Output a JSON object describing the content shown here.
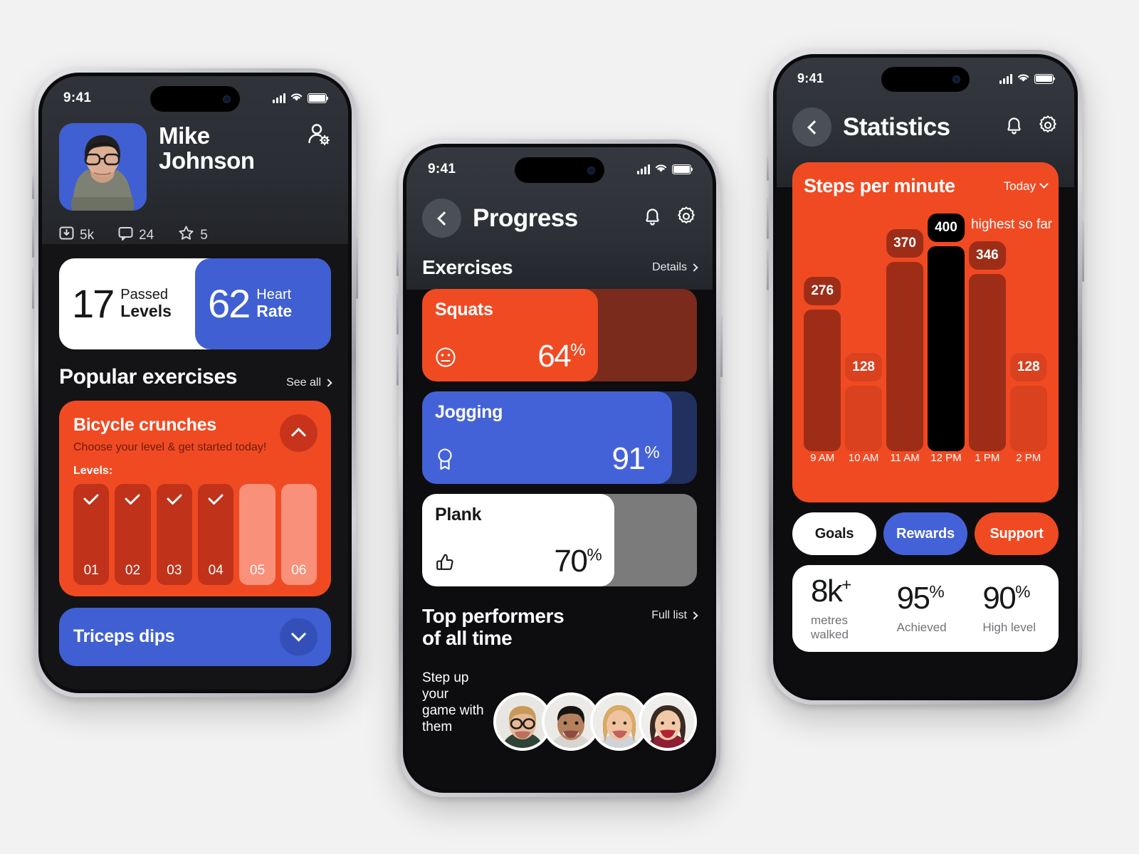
{
  "statusbar": {
    "time": "9:41"
  },
  "phone1": {
    "profile": {
      "name_line1": "Mike",
      "name_line2": "Johnson",
      "account_icon": "person-gear-icon",
      "avatar": "user-avatar",
      "stats": [
        {
          "icon": "download-icon",
          "value": "5k"
        },
        {
          "icon": "comment-icon",
          "value": "24"
        },
        {
          "icon": "star-icon",
          "value": "5"
        }
      ]
    },
    "kpi": [
      {
        "number": "17",
        "label_small": "Passed",
        "label_big": "Levels",
        "theme": "white"
      },
      {
        "number": "62",
        "label_small": "Heart",
        "label_big": "Rate",
        "theme": "blue"
      }
    ],
    "section": {
      "title": "Popular exercises",
      "link": "See all"
    },
    "exercise_card": {
      "title": "Bicycle crunches",
      "subtitle": "Choose your level & get started today!",
      "levels_label": "Levels:",
      "toggle_icon": "chevron-up-icon",
      "levels": [
        {
          "num": "01",
          "done": true
        },
        {
          "num": "02",
          "done": true
        },
        {
          "num": "03",
          "done": true
        },
        {
          "num": "04",
          "done": true
        },
        {
          "num": "05",
          "done": false
        },
        {
          "num": "06",
          "done": false
        }
      ]
    },
    "collapsed_card": {
      "title": "Triceps dips",
      "toggle_icon": "chevron-down-icon"
    }
  },
  "phone2": {
    "nav": {
      "back_icon": "chevron-left-icon",
      "title": "Progress",
      "bell_icon": "bell-icon",
      "gear_icon": "gear-icon"
    },
    "section": {
      "title": "Exercises",
      "link": "Details"
    },
    "progress": [
      {
        "name": "Squats",
        "value": 64,
        "value_text": "64",
        "unit": "%",
        "icon": "neutral-face-icon",
        "fill": "#f04a23",
        "track": "#7a2b1c",
        "text": "#ffffff"
      },
      {
        "name": "Jogging",
        "value": 91,
        "value_text": "91",
        "unit": "%",
        "icon": "medal-icon",
        "fill": "#4462d8",
        "track": "#22305f",
        "text": "#ffffff"
      },
      {
        "name": "Plank",
        "value": 70,
        "value_text": "70",
        "unit": "%",
        "icon": "thumbs-up-icon",
        "fill": "#ffffff",
        "track": "#7b7b7b",
        "text": "#17181a"
      }
    ],
    "top_performers": {
      "title_line1": "Top performers",
      "title_line2": "of all time",
      "link": "Full list",
      "subtitle": "Step up your\ngame with them",
      "avatars": [
        "performer-1",
        "performer-2",
        "performer-3",
        "performer-4"
      ]
    }
  },
  "phone3": {
    "nav": {
      "back_icon": "chevron-left-icon",
      "title": "Statistics",
      "bell_icon": "bell-icon",
      "gear_icon": "gear-icon"
    },
    "chart_card": {
      "title": "Steps per minute",
      "range": "Today",
      "range_icon": "chevron-down-icon",
      "highest_note": "highest so far"
    },
    "chips": [
      {
        "label": "Goals",
        "bg": "#ffffff",
        "fg": "#17181a"
      },
      {
        "label": "Rewards",
        "bg": "#4462d8",
        "fg": "#ffffff"
      },
      {
        "label": "Support",
        "bg": "#f04a23",
        "fg": "#ffffff"
      }
    ],
    "summary": [
      {
        "value": "8k",
        "sup": "+",
        "label": "metres walked"
      },
      {
        "value": "95",
        "sup": "%",
        "label": "Achieved"
      },
      {
        "value": "90",
        "sup": "%",
        "label": "High level"
      }
    ]
  },
  "chart_data": {
    "type": "bar",
    "title": "Steps per minute",
    "subtitle": "Today",
    "xlabel": "",
    "ylabel": "Steps per minute",
    "categories": [
      "9 AM",
      "10 AM",
      "11 AM",
      "12 PM",
      "1 PM",
      "2 PM"
    ],
    "values": [
      276,
      128,
      370,
      400,
      346,
      128
    ],
    "labels": [
      "276",
      "128",
      "370",
      "400",
      "346",
      "128"
    ],
    "highlight_index": 3,
    "highlight_note": "highest so far",
    "ylim": [
      0,
      400
    ],
    "grid": false,
    "legend": false,
    "colors": {
      "card_bg": "#f04a23",
      "bar": "#9e2d18",
      "bar_light": "#d9411f",
      "bar_highlight": "#000000",
      "badge": "#9e2d18",
      "badge_light": "#d9411f",
      "badge_highlight": "#000000",
      "label": "#ffffff"
    },
    "bar_shades": [
      "dark",
      "light",
      "dark",
      "highlight",
      "dark",
      "light"
    ]
  }
}
